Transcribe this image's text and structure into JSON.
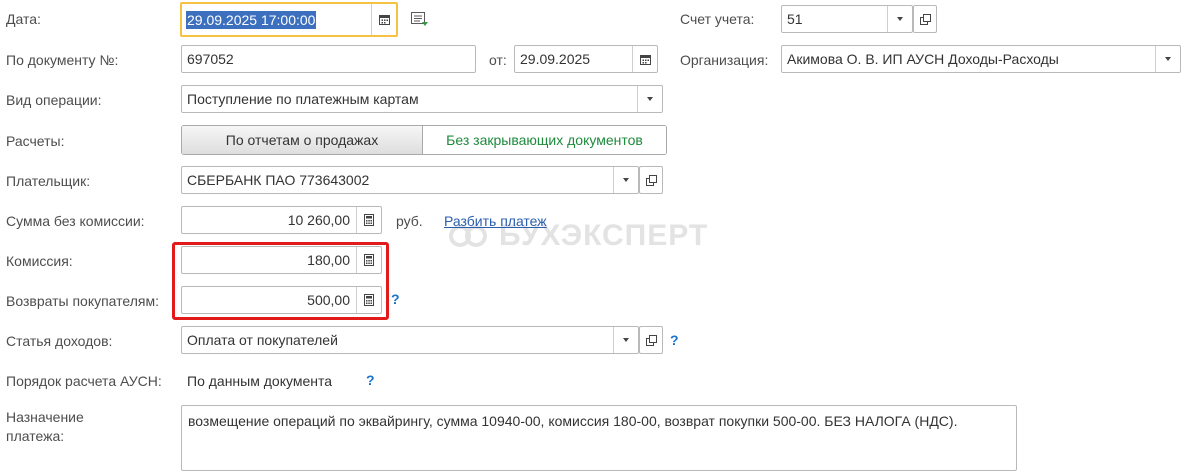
{
  "labels": {
    "date": "Дата:",
    "doc_number": "По документу №:",
    "from": "от:",
    "operation_type": "Вид операции:",
    "settlements": "Расчеты:",
    "payer": "Плательщик:",
    "amount": "Сумма без комиссии:",
    "currency": "руб.",
    "commission": "Комиссия:",
    "returns": "Возвраты покупателям:",
    "income_item": "Статья доходов:",
    "ausn_order": "Порядок расчета АУСН:",
    "purpose": "Назначение платежа:",
    "account": "Счет учета:",
    "organization": "Организация:"
  },
  "fields": {
    "date": "29.09.2025 17:00:00",
    "doc_number": "697052",
    "doc_date": "29.09.2025",
    "operation_type": "Поступление по платежным картам",
    "payer": "СБЕРБАНК ПАО 773643002",
    "amount": "10 260,00",
    "commission": "180,00",
    "returns": "500,00",
    "income_item": "Оплата от покупателей",
    "ausn_order": "По данным документа",
    "purpose": "возмещение операций по эквайрингу, сумма 10940-00, комиссия 180-00, возврат покупки 500-00. БЕЗ НАЛОГА (НДС).",
    "account": "51",
    "organization": "Акимова О. В. ИП АУСН Доходы-Расходы"
  },
  "toggle": {
    "option1": "По отчетам о продажах",
    "option2": "Без закрывающих документов"
  },
  "links": {
    "split_payment": "Разбить платеж"
  },
  "help": "?",
  "watermark": "БУХЭКСПЕРТ",
  "colors": {
    "focus_border": "#f5c242",
    "selection": "#3d6fbf",
    "highlight_box": "#e31a1a",
    "link": "#2a5db0",
    "help": "#1a73c9",
    "toggle_active_text": "#1e8a3c"
  }
}
